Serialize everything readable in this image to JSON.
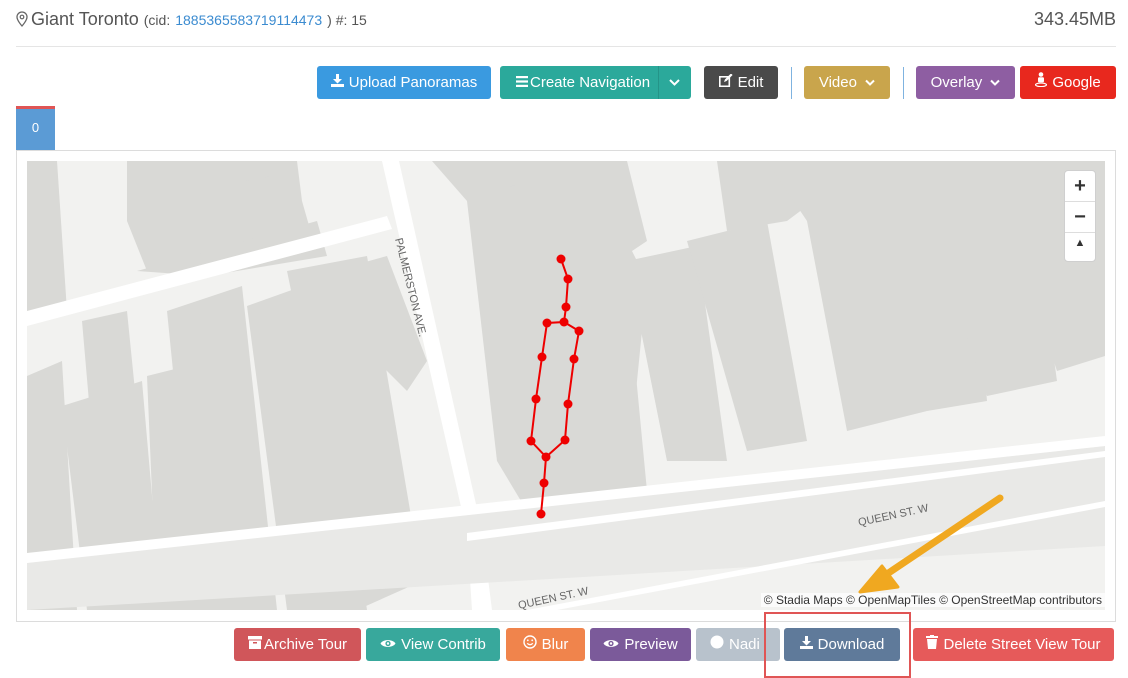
{
  "header": {
    "title": "Giant Toronto",
    "cid_prefix": "(cid:",
    "cid": "1885365583719114473",
    "cid_suffix": ") #: 15",
    "size": "343.45MB"
  },
  "toolbar": {
    "upload": "Upload Panoramas",
    "create_nav": "Create Navigation",
    "edit": "Edit",
    "video": "Video",
    "overlay": "Overlay",
    "google": "Google"
  },
  "tabs": [
    "0"
  ],
  "map": {
    "streets": [
      "PALMERSTON AVE.",
      "QUEEN ST. W",
      "QUEEN ST. W"
    ],
    "zoom_in": "+",
    "zoom_out": "−",
    "compass": "▲",
    "attribution": "© Stadia Maps © OpenMapTiles © OpenStreetMap contributors"
  },
  "actions": {
    "archive": "Archive Tour",
    "view_contrib": "View Contrib",
    "blur": "Blur",
    "preview": "Preview",
    "nadir": "Nadi",
    "download": "Download",
    "delete": "Delete Street View Tour"
  },
  "colors": {
    "blue": "#3a9ae0",
    "teal": "#2ba99b",
    "dark": "#4a4a4a",
    "gold": "#c9a54c",
    "purple": "#8e5ea2",
    "red": "#e8281e",
    "archive": "#d0565a",
    "contrib": "#38a89c",
    "blur": "#f0844c",
    "preview": "#7b5a9a",
    "nadir": "#b8c2cc",
    "download": "#5f7a9a",
    "delete": "#e65a5a",
    "path": "#ee0000",
    "arrow": "#f0a820"
  }
}
